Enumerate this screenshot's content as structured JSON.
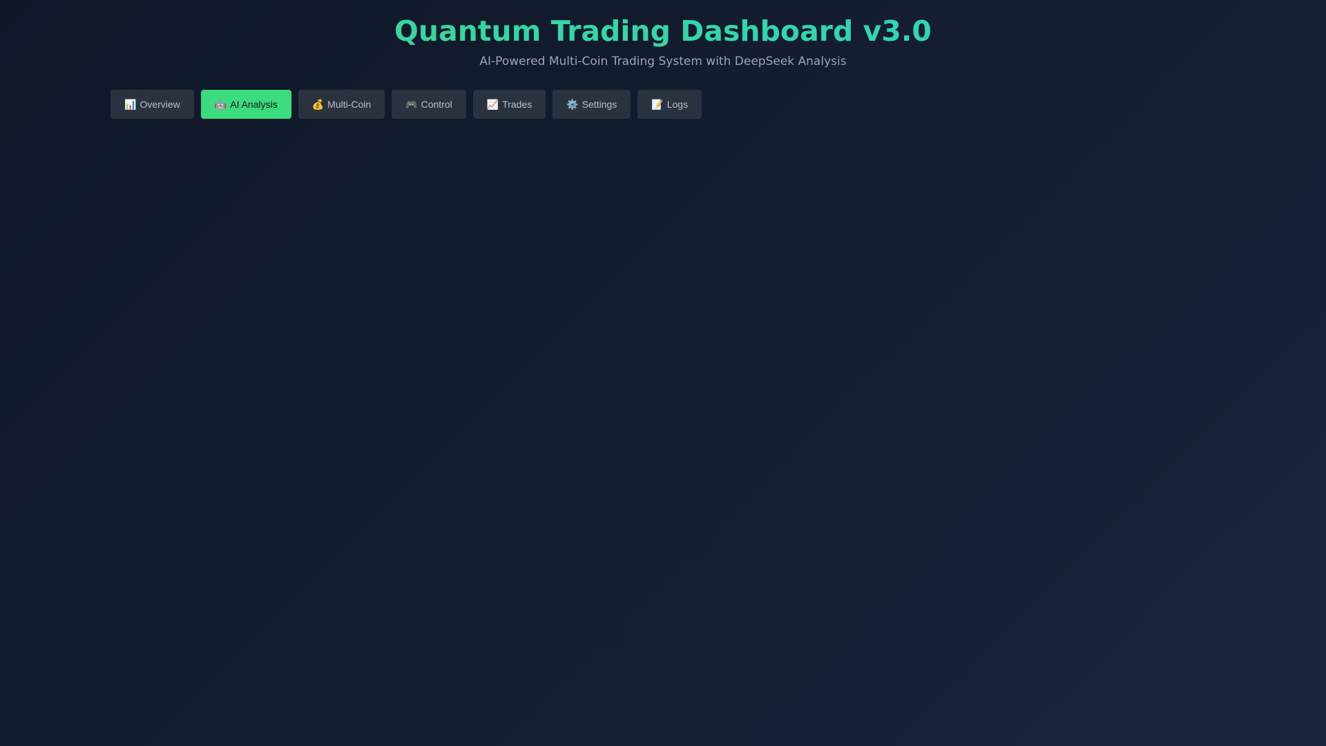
{
  "header": {
    "title": "Quantum Trading Dashboard v3.0",
    "subtitle": "AI-Powered Multi-Coin Trading System with DeepSeek Analysis"
  },
  "nav": {
    "active_tab": "AI Analysis",
    "tabs": [
      {
        "label": "Overview",
        "icon": "📊",
        "icon_name": "bar-chart-icon"
      },
      {
        "label": "AI Analysis",
        "icon": "🤖",
        "icon_name": "robot-icon"
      },
      {
        "label": "Multi-Coin",
        "icon": "💰",
        "icon_name": "money-bag-icon"
      },
      {
        "label": "Control",
        "icon": "🎮",
        "icon_name": "game-controller-icon"
      },
      {
        "label": "Trades",
        "icon": "📈",
        "icon_name": "trending-up-icon"
      },
      {
        "label": "Settings",
        "icon": "⚙️",
        "icon_name": "gear-icon"
      },
      {
        "label": "Logs",
        "icon": "📝",
        "icon_name": "memo-icon"
      }
    ]
  },
  "colors": {
    "accent_green": "#3ddb7f",
    "accent_teal": "#2cd4c0",
    "tab_background": "#2a313f",
    "page_background": "#141d31"
  }
}
